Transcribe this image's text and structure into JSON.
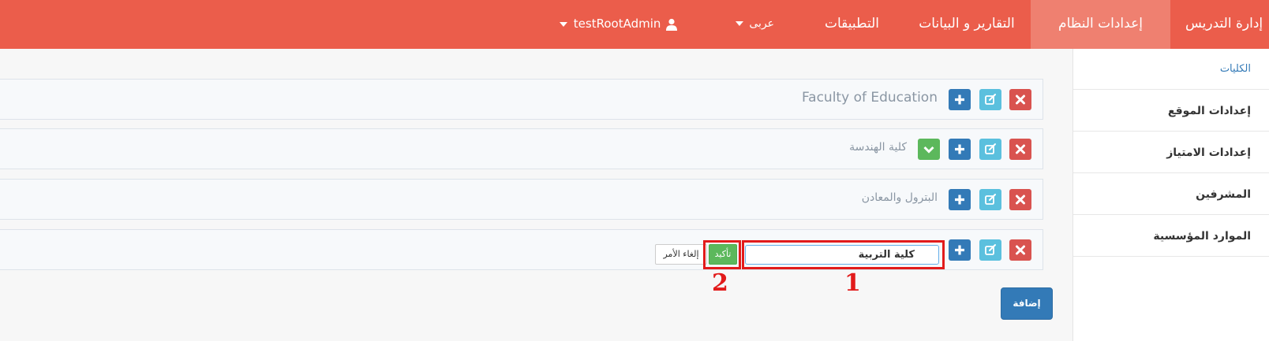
{
  "navbar": {
    "items": [
      {
        "label": "إدارة التدريس"
      },
      {
        "label": "إعدادات النظام"
      },
      {
        "label": "التقارير و البيانات"
      },
      {
        "label": "التطبيقات"
      }
    ],
    "language_label": "عربى",
    "user_label": "testRootAdmin",
    "bg_color": "#eb5d4b",
    "active_bg_color": "#ef8070"
  },
  "sidebar": {
    "items": [
      {
        "label": "الكليات"
      },
      {
        "label": "إعدادات الموقع"
      },
      {
        "label": "إعدادات الامتياز"
      },
      {
        "label": "المشرفين"
      },
      {
        "label": "الموارد المؤسسية"
      }
    ]
  },
  "faculties": [
    {
      "name": "Faculty of Education"
    },
    {
      "name": "كلية الهندسة"
    },
    {
      "name": "البترول والمعادن"
    }
  ],
  "edit_row": {
    "input_value": "كلية التربية",
    "confirm_label": "تأكيد",
    "cancel_label": "إلغاء الأمر"
  },
  "add_button_label": "إضافة",
  "annotations": {
    "marker_1": "1",
    "marker_2": "2",
    "color": "#e21b1b"
  }
}
